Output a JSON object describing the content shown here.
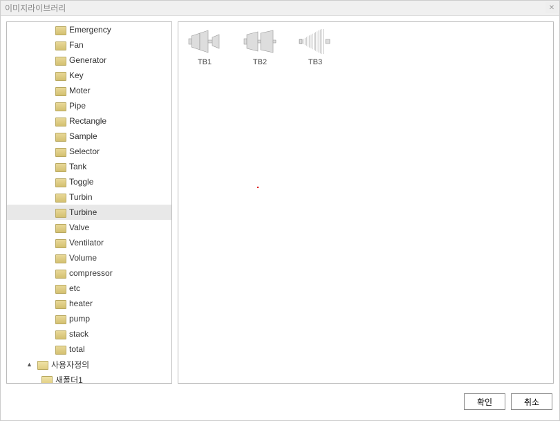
{
  "window": {
    "title": "이미지라이브러리"
  },
  "tree": {
    "folders": [
      "Emergency",
      "Fan",
      "Generator",
      "Key",
      "Moter",
      "Pipe",
      "Rectangle",
      "Sample",
      "Selector",
      "Tank",
      "Toggle",
      "Turbin",
      "Turbine",
      "Valve",
      "Ventilator",
      "Volume",
      "compressor",
      "etc",
      "heater",
      "pump",
      "stack",
      "total"
    ],
    "selected": "Turbine",
    "userRoot": {
      "label": "사용자정의",
      "expanded": true
    },
    "userChild": {
      "label": "새폴더1"
    }
  },
  "thumbnails": {
    "items": [
      {
        "label": "TB1"
      },
      {
        "label": "TB2"
      },
      {
        "label": "TB3"
      }
    ]
  },
  "buttons": {
    "ok": "확인",
    "cancel": "취소"
  }
}
